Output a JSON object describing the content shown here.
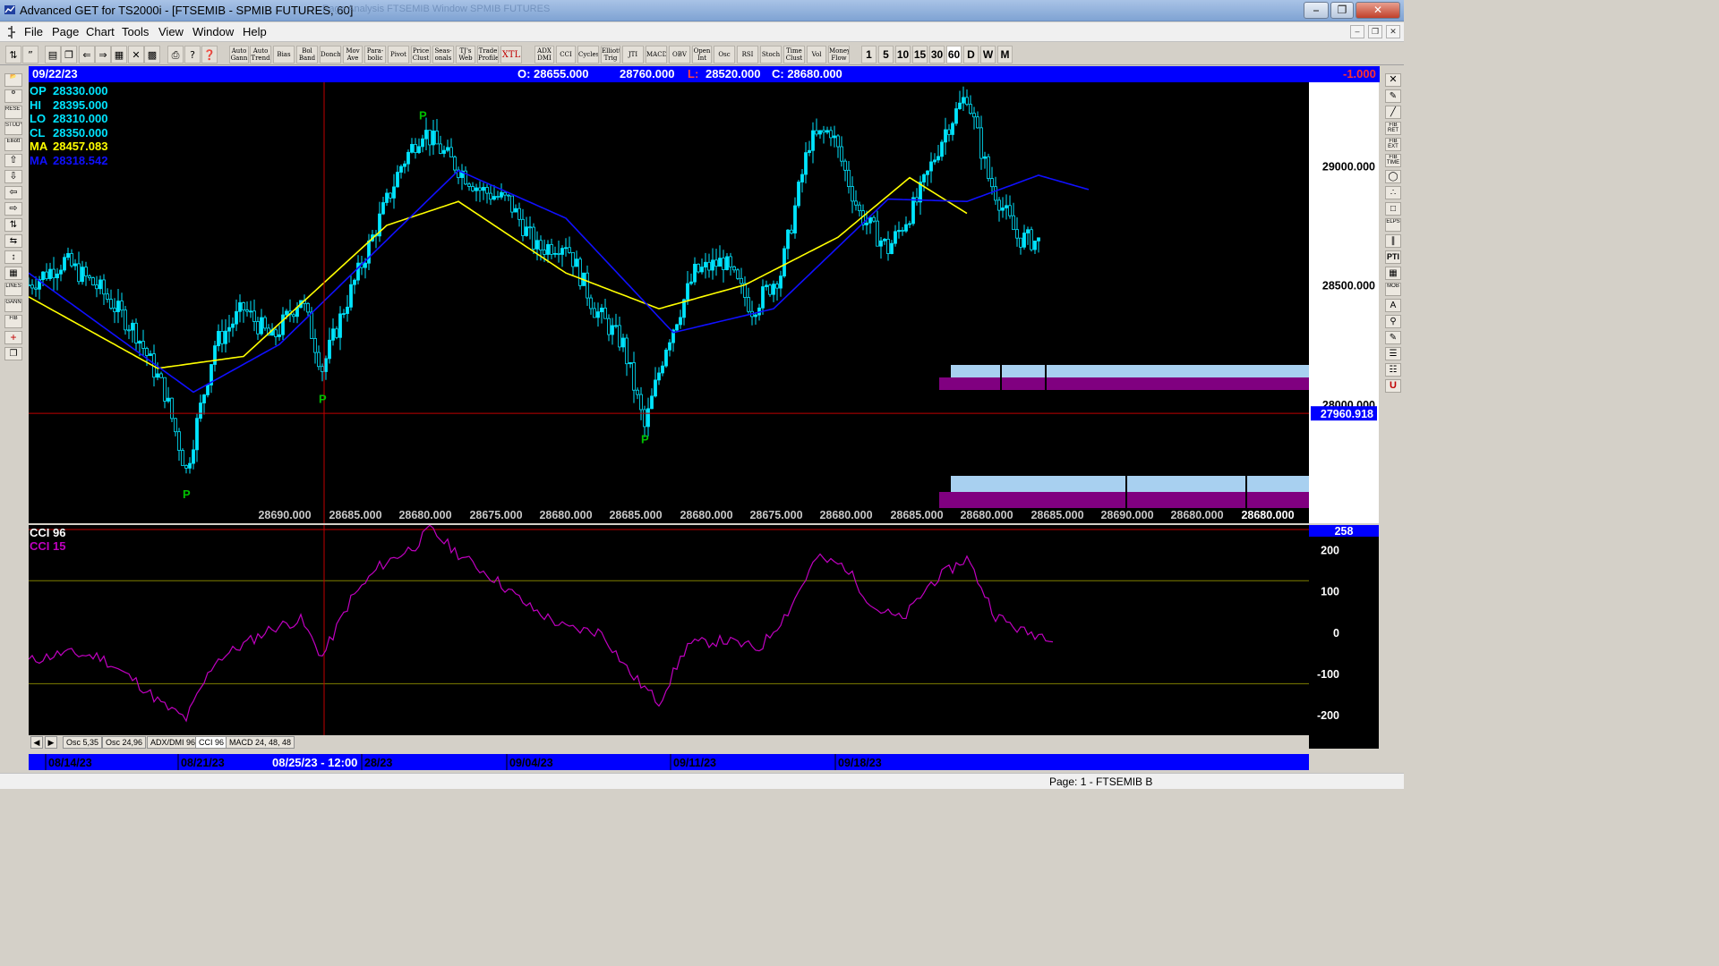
{
  "window": {
    "title": "Advanced GET for TS2000i - [FTSEMIB - SPMIB FUTURES, 60]",
    "ghost_text": "Page Analysis  FTSEMIB Window SPMIB FUTURES"
  },
  "menu": [
    "File",
    "Page",
    "Chart",
    "Tools",
    "View",
    "Window",
    "Help"
  ],
  "toolbar": {
    "studies": [
      "Auto Gann",
      "Auto Trend",
      "Bias",
      "Bol Band",
      "Donch",
      "Mov Ave",
      "Para-bolic",
      "Pivot",
      "Price Clust",
      "Seas-onals",
      "TJ's Web",
      "Trade Profile",
      "XTL",
      "ADX DMI",
      "CCI",
      "Cycles",
      "Elliott Trig",
      "JTI",
      "MACD",
      "OBV",
      "Open Int",
      "Osc",
      "RSI",
      "Stoch",
      "Time Clust",
      "Vol",
      "Money Flow"
    ],
    "timeframes": [
      "1",
      "5",
      "10",
      "15",
      "30",
      "60",
      "D",
      "W",
      "M"
    ]
  },
  "infobar": {
    "date": "09/22/23",
    "open": "O: 28655.000",
    "high": "28760.000",
    "low_label": "L:",
    "low": "28520.000",
    "close": "C: 28680.000",
    "change": "-1.000"
  },
  "readout": [
    {
      "label": "OP",
      "value": "28330.000",
      "color": "#00e5ff"
    },
    {
      "label": "HI",
      "value": "28395.000",
      "color": "#00e5ff"
    },
    {
      "label": "LO",
      "value": "28310.000",
      "color": "#00e5ff"
    },
    {
      "label": "CL",
      "value": "28350.000",
      "color": "#00e5ff"
    },
    {
      "label": "MA",
      "value": "28457.083",
      "color": "#ffff00"
    },
    {
      "label": "MA",
      "value": "28318.542",
      "color": "#1010ff"
    }
  ],
  "price_axis": {
    "ticks": [
      "29000.000",
      "28500.000",
      "28000.000"
    ],
    "current_price_label": "27960.918"
  },
  "pivot_label": "P",
  "bottom_price_labels": [
    "28690.000",
    "28685.000",
    "28680.000",
    "28675.000",
    "28680.000",
    "28685.000",
    "28680.000",
    "28675.000",
    "28680.000",
    "28685.000",
    "28680.000",
    "28685.000",
    "28690.000",
    "28680.000",
    "28680.000"
  ],
  "cci_panel": {
    "title_1": "CCI 96",
    "title_2": "CCI  15",
    "current_value": "258",
    "ticks": [
      "200",
      "100",
      "0",
      "-100",
      "-200"
    ]
  },
  "tabs": [
    "Osc 5,35",
    "Osc 24,96",
    "ADX/DMI 96",
    "CCI 96",
    "MACD 24, 48, 48"
  ],
  "datebar": {
    "labels": [
      "08/14/23",
      "08/21/23",
      "28/23",
      "09/04/23",
      "09/11/23",
      "09/18/23"
    ],
    "selected": "08/25/23 - 12:00"
  },
  "status": "Page: 1 - FTSEMIB B",
  "colors": {
    "candle": "#00e5ff",
    "ma_fast": "#ffff00",
    "ma_slow": "#1010ff",
    "cci": "#c000c0",
    "cursor": "#c00000",
    "light_box": "#a8d0f0",
    "purple_box": "#800080"
  },
  "chart_data": [
    {
      "type": "candlestick",
      "symbol": "FTSEMIB - SPMIB FUTURES",
      "timeframe": "60",
      "ylim": [
        27500,
        29350
      ],
      "yticks": [
        28000,
        28500,
        29000
      ],
      "current_price": 27960.918,
      "date_ticks": [
        "08/14/23",
        "08/21/23",
        "09/04/23",
        "09/11/23",
        "09/18/23"
      ],
      "close_path": [
        {
          "t": 0,
          "c": 28500
        },
        {
          "t": 10,
          "c": 28600
        },
        {
          "t": 20,
          "c": 28480
        },
        {
          "t": 30,
          "c": 28300
        },
        {
          "t": 38,
          "c": 28050
        },
        {
          "t": 44,
          "c": 27720
        },
        {
          "t": 52,
          "c": 28250
        },
        {
          "t": 60,
          "c": 28400
        },
        {
          "t": 68,
          "c": 28270
        },
        {
          "t": 76,
          "c": 28450
        },
        {
          "t": 82,
          "c": 28150
        },
        {
          "t": 88,
          "c": 28400
        },
        {
          "t": 96,
          "c": 28700
        },
        {
          "t": 104,
          "c": 29000
        },
        {
          "t": 110,
          "c": 29150
        },
        {
          "t": 118,
          "c": 29020
        },
        {
          "t": 126,
          "c": 28900
        },
        {
          "t": 134,
          "c": 28850
        },
        {
          "t": 142,
          "c": 28650
        },
        {
          "t": 150,
          "c": 28680
        },
        {
          "t": 158,
          "c": 28400
        },
        {
          "t": 166,
          "c": 28250
        },
        {
          "t": 172,
          "c": 27900
        },
        {
          "t": 178,
          "c": 28250
        },
        {
          "t": 186,
          "c": 28550
        },
        {
          "t": 194,
          "c": 28600
        },
        {
          "t": 202,
          "c": 28400
        },
        {
          "t": 210,
          "c": 28550
        },
        {
          "t": 218,
          "c": 29100
        },
        {
          "t": 224,
          "c": 29150
        },
        {
          "t": 232,
          "c": 28800
        },
        {
          "t": 240,
          "c": 28650
        },
        {
          "t": 248,
          "c": 28850
        },
        {
          "t": 256,
          "c": 29150
        },
        {
          "t": 262,
          "c": 29300
        },
        {
          "t": 268,
          "c": 28950
        },
        {
          "t": 276,
          "c": 28700
        },
        {
          "t": 282,
          "c": 28680
        }
      ],
      "ma_fast_path": [
        {
          "t": 0,
          "v": 28450
        },
        {
          "t": 36,
          "v": 28150
        },
        {
          "t": 60,
          "v": 28200
        },
        {
          "t": 100,
          "v": 28750
        },
        {
          "t": 120,
          "v": 28850
        },
        {
          "t": 150,
          "v": 28550
        },
        {
          "t": 176,
          "v": 28400
        },
        {
          "t": 200,
          "v": 28500
        },
        {
          "t": 226,
          "v": 28700
        },
        {
          "t": 246,
          "v": 28950
        },
        {
          "t": 262,
          "v": 28800
        }
      ],
      "ma_slow_path": [
        {
          "t": 0,
          "v": 28550
        },
        {
          "t": 46,
          "v": 28050
        },
        {
          "t": 70,
          "v": 28250
        },
        {
          "t": 120,
          "v": 28980
        },
        {
          "t": 150,
          "v": 28780
        },
        {
          "t": 180,
          "v": 28300
        },
        {
          "t": 208,
          "v": 28400
        },
        {
          "t": 240,
          "v": 28860
        },
        {
          "t": 262,
          "v": 28850
        },
        {
          "t": 282,
          "v": 28960
        },
        {
          "t": 296,
          "v": 28900
        }
      ],
      "pivots": [
        {
          "t": 44,
          "price": 27650,
          "pos": "low"
        },
        {
          "t": 82,
          "price": 28050,
          "pos": "low"
        },
        {
          "t": 110,
          "price": 29180,
          "pos": "high"
        },
        {
          "t": 172,
          "price": 27880,
          "pos": "low"
        }
      ]
    },
    {
      "type": "line",
      "title": "CCI 96",
      "series_names": [
        "CCI 96",
        "CCI  15"
      ],
      "ylim": [
        -250,
        260
      ],
      "yticks": [
        200,
        100,
        0,
        -100,
        -200
      ],
      "reference_lines": [
        125,
        -125
      ],
      "current_value": 258,
      "path": [
        {
          "t": 0,
          "v": -70
        },
        {
          "t": 10,
          "v": -50
        },
        {
          "t": 20,
          "v": -60
        },
        {
          "t": 30,
          "v": -120
        },
        {
          "t": 38,
          "v": -180
        },
        {
          "t": 44,
          "v": -210
        },
        {
          "t": 52,
          "v": -70
        },
        {
          "t": 60,
          "v": -30
        },
        {
          "t": 68,
          "v": 10
        },
        {
          "t": 76,
          "v": 30
        },
        {
          "t": 82,
          "v": -60
        },
        {
          "t": 90,
          "v": 80
        },
        {
          "t": 98,
          "v": 160
        },
        {
          "t": 108,
          "v": 210
        },
        {
          "t": 112,
          "v": 250
        },
        {
          "t": 120,
          "v": 190
        },
        {
          "t": 130,
          "v": 130
        },
        {
          "t": 140,
          "v": 60
        },
        {
          "t": 150,
          "v": 10
        },
        {
          "t": 160,
          "v": 0
        },
        {
          "t": 168,
          "v": -100
        },
        {
          "t": 176,
          "v": -170
        },
        {
          "t": 184,
          "v": -30
        },
        {
          "t": 194,
          "v": -20
        },
        {
          "t": 204,
          "v": -40
        },
        {
          "t": 212,
          "v": 50
        },
        {
          "t": 220,
          "v": 180
        },
        {
          "t": 228,
          "v": 160
        },
        {
          "t": 236,
          "v": 60
        },
        {
          "t": 244,
          "v": 30
        },
        {
          "t": 252,
          "v": 120
        },
        {
          "t": 262,
          "v": 180
        },
        {
          "t": 270,
          "v": 40
        },
        {
          "t": 278,
          "v": 0
        },
        {
          "t": 286,
          "v": -10
        }
      ]
    }
  ]
}
